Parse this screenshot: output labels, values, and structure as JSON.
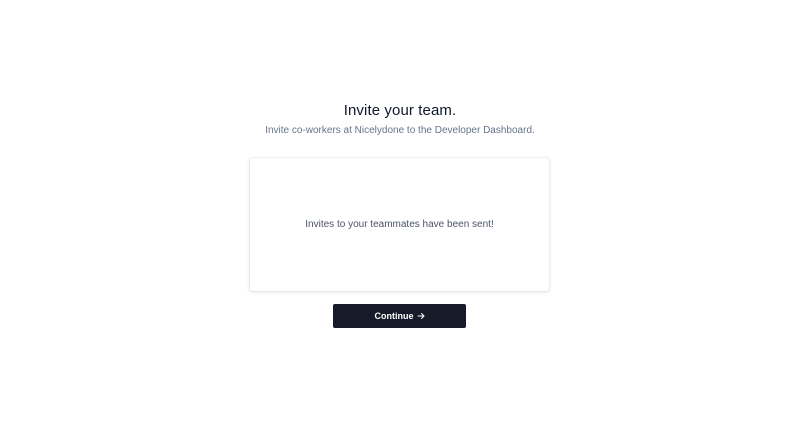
{
  "header": {
    "title": "Invite your team.",
    "subtitle": "Invite co-workers at Nicelydone to the Developer Dashboard."
  },
  "card": {
    "message": "Invites to your teammates have been sent!"
  },
  "actions": {
    "continue_label": "Continue",
    "continue_icon": "arrow-right-icon"
  },
  "colors": {
    "button_bg": "#161b2a",
    "button_text": "#ffffff",
    "title_text": "#0f172a",
    "muted_text": "#64748b"
  }
}
